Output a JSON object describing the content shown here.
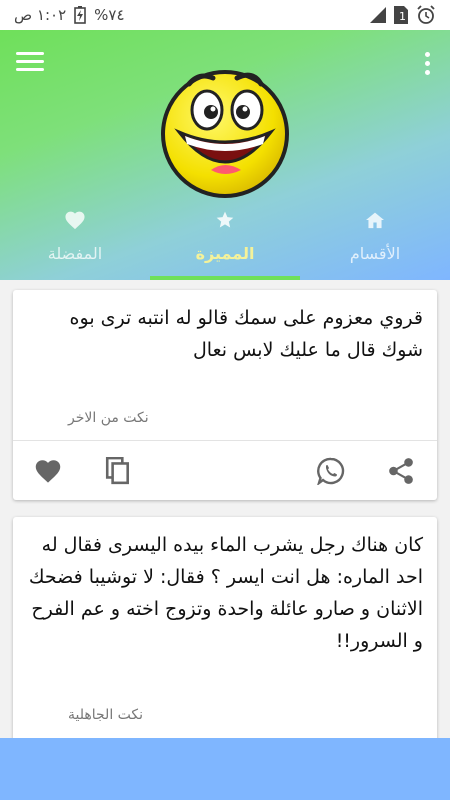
{
  "status_bar": {
    "time": "١:٠٢ ص",
    "battery_percent": "%٧٤",
    "sim_label": "1",
    "icons": [
      "alarm-icon",
      "sim-icon",
      "signal-icon",
      "battery-charging-icon"
    ]
  },
  "header": {
    "menu_icon": "hamburger-menu-icon",
    "more_icon": "more-vert-icon",
    "logo": "laughing-emoji-logo",
    "colors": {
      "gradient_start": "#6fe05a",
      "gradient_end": "#7fb6ff",
      "active_tab": "#f4f29a",
      "indicator": "#6fe05a"
    }
  },
  "tabs": [
    {
      "label": "المفضلة",
      "icon": "heart-icon",
      "active": false
    },
    {
      "label": "المميزة",
      "icon": "star-icon",
      "active": true
    },
    {
      "label": "الأقسام",
      "icon": "home-icon",
      "active": false
    }
  ],
  "cards": [
    {
      "text": "قروي معزوم على سمك قالو له انتبه ترى بوه شوك قال ما عليك لابس نعال",
      "category": "نكت من الاخر",
      "actions": [
        "favorite-icon",
        "copy-icon",
        "whatsapp-icon",
        "share-icon"
      ]
    },
    {
      "text": "كان هناك رجل يشرب الماء بيده اليسرى فقال له احد الماره: هل انت ايسر ؟ فقال: لا توشيبا فضحك الاثنان و صارو عائلة واحدة وتزوج اخته و عم الفرح و السرور!!",
      "category": "نكت الجاهلية"
    }
  ]
}
